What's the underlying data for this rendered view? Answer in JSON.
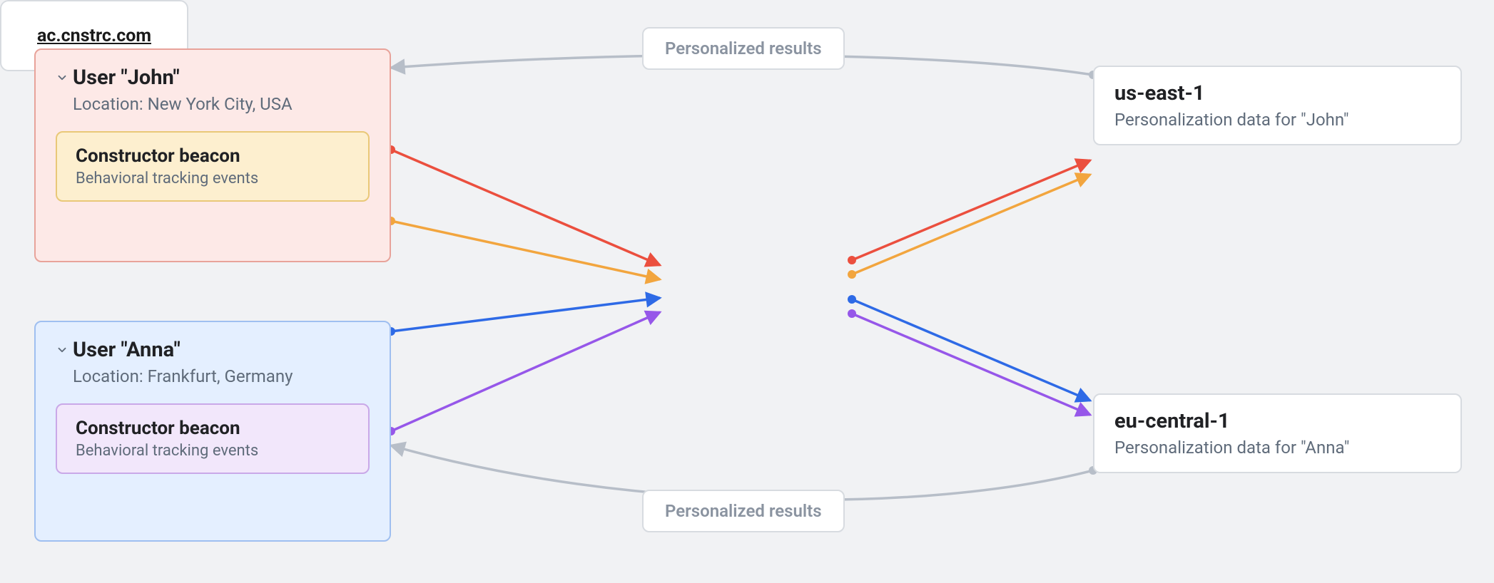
{
  "users": {
    "john": {
      "title": "User \"John\"",
      "location_label": "Location: New York City, USA",
      "beacon": {
        "title": "Constructor beacon",
        "subtitle": "Behavioral tracking events"
      }
    },
    "anna": {
      "title": "User \"Anna\"",
      "location_label": "Location: Frankfurt, Germany",
      "beacon": {
        "title": "Constructor beacon",
        "subtitle": "Behavioral tracking events"
      }
    }
  },
  "center": {
    "label": "ac.cnstrc.com"
  },
  "edge_labels": {
    "top": "Personalized results",
    "bottom": "Personalized results"
  },
  "regions": {
    "us": {
      "title": "us-east-1",
      "subtitle": "Personalization data for \"John\""
    },
    "eu": {
      "title": "eu-central-1",
      "subtitle": "Personalization data for \"Anna\""
    }
  },
  "colors": {
    "red": "#eb4f3e",
    "orange": "#f2a53e",
    "blue": "#2e6ae6",
    "purple": "#9657e9",
    "grey": "#b7bec8"
  }
}
